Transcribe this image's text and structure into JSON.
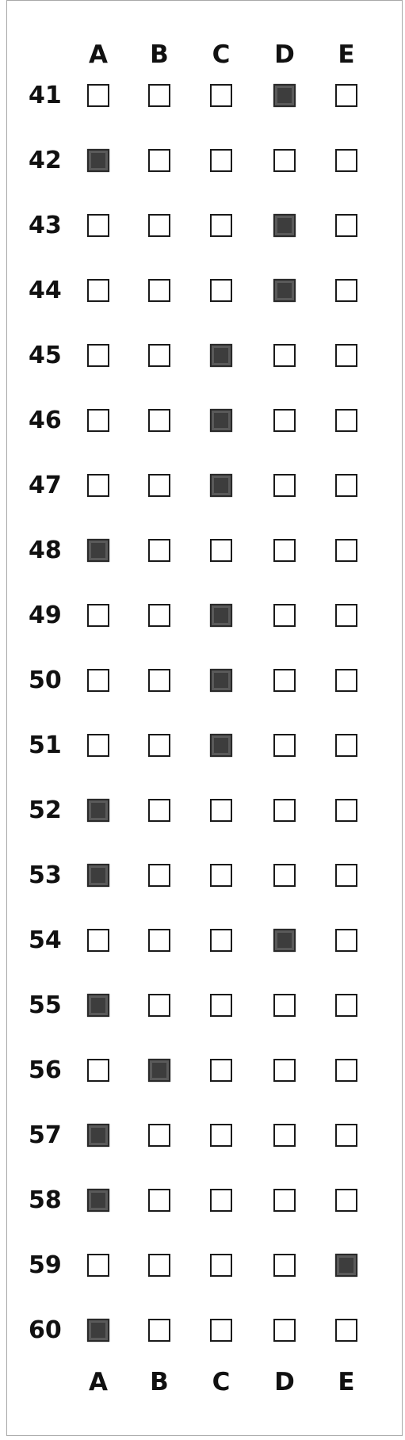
{
  "sheet": {
    "column_letters": [
      "A",
      "B",
      "C",
      "D",
      "E"
    ],
    "questions": [
      {
        "number": "41",
        "marked": "D"
      },
      {
        "number": "42",
        "marked": "A"
      },
      {
        "number": "43",
        "marked": "D"
      },
      {
        "number": "44",
        "marked": "D"
      },
      {
        "number": "45",
        "marked": "C"
      },
      {
        "number": "46",
        "marked": "C"
      },
      {
        "number": "47",
        "marked": "C"
      },
      {
        "number": "48",
        "marked": "A"
      },
      {
        "number": "49",
        "marked": "C"
      },
      {
        "number": "50",
        "marked": "C"
      },
      {
        "number": "51",
        "marked": "C"
      },
      {
        "number": "52",
        "marked": "A"
      },
      {
        "number": "53",
        "marked": "A"
      },
      {
        "number": "54",
        "marked": "D"
      },
      {
        "number": "55",
        "marked": "A"
      },
      {
        "number": "56",
        "marked": "B"
      },
      {
        "number": "57",
        "marked": "A"
      },
      {
        "number": "58",
        "marked": "A"
      },
      {
        "number": "59",
        "marked": "E"
      },
      {
        "number": "60",
        "marked": "A"
      }
    ]
  },
  "colors": {
    "ink": "#111111",
    "bubble_border": "#1a1a1a",
    "bubble_fill": "#3d3d3d",
    "sheet_border": "#a8a8a8"
  }
}
